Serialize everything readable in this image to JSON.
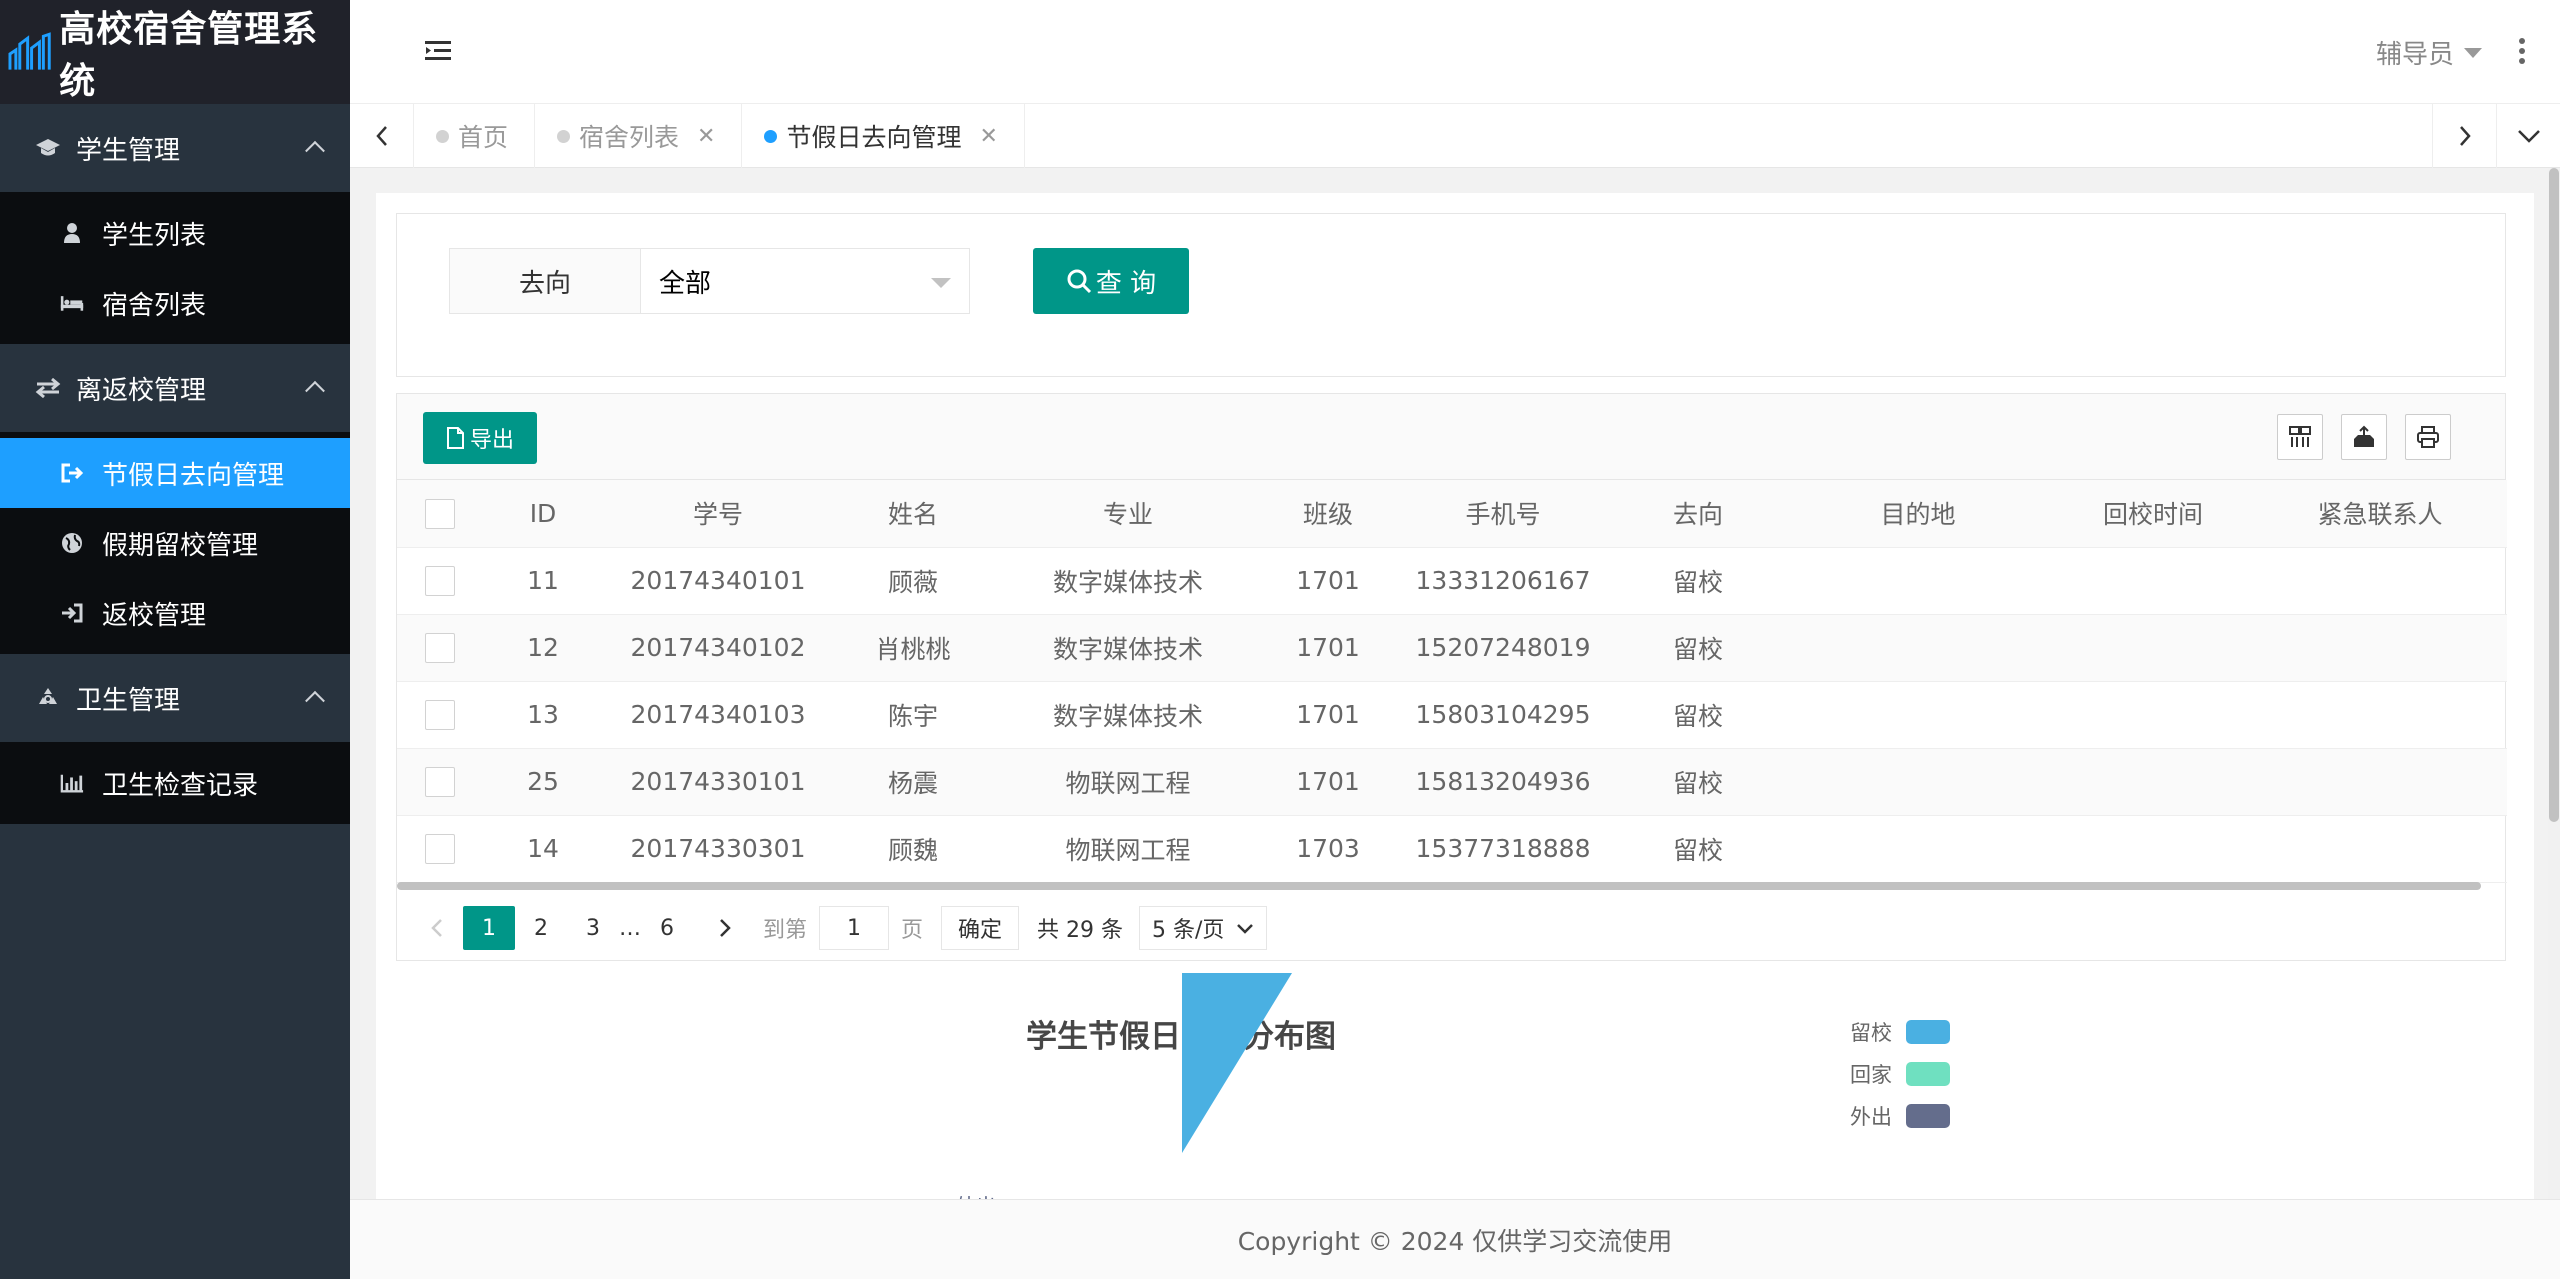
{
  "app": {
    "title": "高校宿舍管理系统"
  },
  "sidebar": {
    "groups": [
      {
        "label": "学生管理",
        "icon": "graduation-cap-icon",
        "items": [
          {
            "label": "学生列表",
            "icon": "user-icon"
          },
          {
            "label": "宿舍列表",
            "icon": "bed-icon"
          }
        ]
      },
      {
        "label": "离返校管理",
        "icon": "exchange-icon",
        "items": [
          {
            "label": "节假日去向管理",
            "icon": "sign-out-icon",
            "active": true
          },
          {
            "label": "假期留校管理",
            "icon": "globe-icon"
          },
          {
            "label": "返校管理",
            "icon": "sign-in-icon"
          }
        ]
      },
      {
        "label": "卫生管理",
        "icon": "recycle-icon",
        "items": [
          {
            "label": "卫生检查记录",
            "icon": "bar-chart-icon"
          }
        ]
      }
    ]
  },
  "header": {
    "user": "辅导员"
  },
  "tabs": [
    {
      "label": "首页",
      "closable": false,
      "active": false
    },
    {
      "label": "宿舍列表",
      "closable": true,
      "active": false
    },
    {
      "label": "节假日去向管理",
      "closable": true,
      "active": true
    }
  ],
  "search": {
    "field_label": "去向",
    "select_value": "全部",
    "query_button": "查 询"
  },
  "table": {
    "export_button": "导出",
    "columns": [
      "ID",
      "学号",
      "姓名",
      "专业",
      "班级",
      "手机号",
      "去向",
      "目的地",
      "回校时间",
      "紧急联系人"
    ],
    "rows": [
      [
        "11",
        "20174340101",
        "顾薇",
        "数字媒体技术",
        "1701",
        "13331206167",
        "留校",
        "",
        "",
        ""
      ],
      [
        "12",
        "20174340102",
        "肖桃桃",
        "数字媒体技术",
        "1701",
        "15207248019",
        "留校",
        "",
        "",
        ""
      ],
      [
        "13",
        "20174340103",
        "陈宇",
        "数字媒体技术",
        "1701",
        "15803104295",
        "留校",
        "",
        "",
        ""
      ],
      [
        "25",
        "20174330101",
        "杨震",
        "物联网工程",
        "1701",
        "15813204936",
        "留校",
        "",
        "",
        ""
      ],
      [
        "14",
        "20174330301",
        "顾魏",
        "物联网工程",
        "1703",
        "15377318888",
        "留校",
        "",
        "",
        ""
      ]
    ]
  },
  "pagination": {
    "pages": [
      "1",
      "2",
      "3",
      "…",
      "6"
    ],
    "current": "1",
    "goto_label": "到第",
    "goto_value": "1",
    "page_unit": "页",
    "confirm": "确定",
    "total": "共 29 条",
    "page_size": "5 条/页"
  },
  "chart": {
    "title": "学生节假日去向分布图",
    "legend": [
      {
        "label": "留校",
        "color": "#4ab0e2"
      },
      {
        "label": "回家",
        "color": "#6fe0c0"
      },
      {
        "label": "外出",
        "color": "#646d8c"
      }
    ],
    "visible_label": "外出"
  },
  "chart_data": {
    "type": "pie",
    "title": "学生节假日去向分布图",
    "categories": [
      "留校",
      "回家",
      "外出"
    ],
    "colors": [
      "#4ab0e2",
      "#6fe0c0",
      "#646d8c"
    ],
    "legend": "top-right"
  },
  "footer": {
    "text": "Copyright © 2024 仅供学习交流使用"
  },
  "colors": {
    "accent": "#009688",
    "active_menu": "#1e9fff",
    "sidebar": "#28333e"
  }
}
